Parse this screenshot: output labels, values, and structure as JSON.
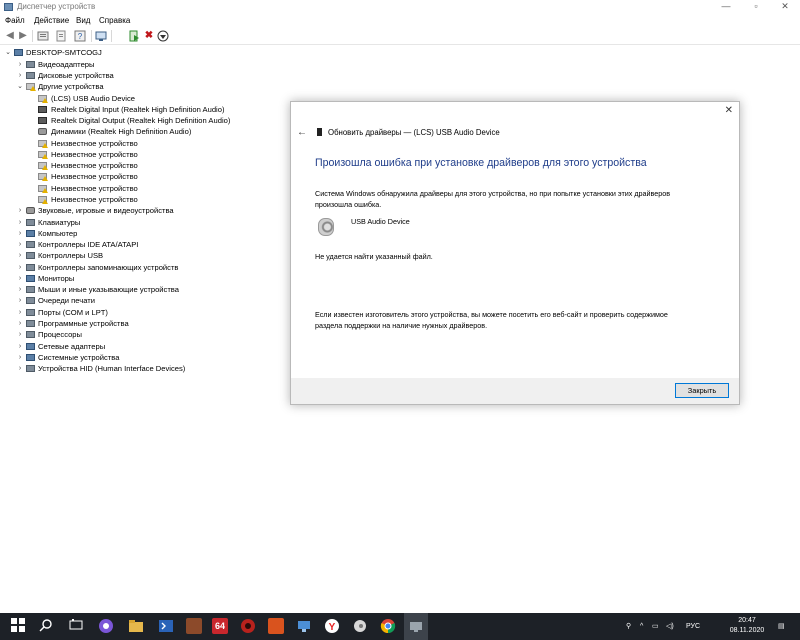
{
  "window": {
    "title": "Диспетчер устройств",
    "minimize": "—",
    "maximize": "▫",
    "close": "✕"
  },
  "menu": [
    "Файл",
    "Действие",
    "Вид",
    "Справка"
  ],
  "toolbar": [
    "back",
    "forward",
    "properties",
    "refresh",
    "help",
    "scan",
    "enable",
    "uninstall",
    "update"
  ],
  "tree": {
    "root": "DESKTOP-SMTCOGJ",
    "items": [
      "Видеоадаптеры",
      "Дисковые устройства",
      "Другие устройства",
      "(LCS) USB Audio Device",
      "Realtek Digital Input (Realtek High Definition Audio)",
      "Realtek Digital Output (Realtek High Definition Audio)",
      "Динамики (Realtek High Definition Audio)",
      "Неизвестное устройство",
      "Неизвестное устройство",
      "Неизвестное устройство",
      "Неизвестное устройство",
      "Неизвестное устройство",
      "Неизвестное устройство",
      "Звуковые, игровые и видеоустройства",
      "Клавиатуры",
      "Компьютер",
      "Контроллеры IDE ATA/ATAPI",
      "Контроллеры USB",
      "Контроллеры запоминающих устройств",
      "Мониторы",
      "Мыши и иные указывающие устройства",
      "Очереди печати",
      "Порты (COM и LPT)",
      "Программные устройства",
      "Процессоры",
      "Сетевые адаптеры",
      "Системные устройства",
      "Устройства HID (Human Interface Devices)"
    ]
  },
  "dialog": {
    "title": "Обновить драйверы — (LCS) USB Audio Device",
    "heading": "Произошла ошибка при установке драйверов для этого устройства",
    "message": "Система Windows обнаружила драйверы для этого устройства, но при попытке установки этих драйверов произошла ошибка.",
    "device_name": "USB Audio Device",
    "error": "Не удается найти указанный файл.",
    "help": "Если известен изготовитель этого устройства, вы можете посетить его веб-сайт и проверить содержимое раздела поддержки на наличие нужных драйверов.",
    "close_button": "Закрыть",
    "close_x": "✕",
    "back": "←"
  },
  "taskbar": {
    "apps": [
      "start",
      "search",
      "task-view",
      "app-purple",
      "file-explorer",
      "powershell",
      "game",
      "aida64",
      "app-red",
      "app-orange",
      "app-network",
      "yandex",
      "app-white",
      "chrome",
      "device-manager"
    ],
    "aida_label": "64",
    "tray_chevron": "^",
    "language": "РУС",
    "time": "20:47",
    "date": "08.11.2020"
  },
  "colors": {
    "heading": "#1f3d8a",
    "button_border": "#0078d7",
    "taskbar": "#1d2127"
  }
}
